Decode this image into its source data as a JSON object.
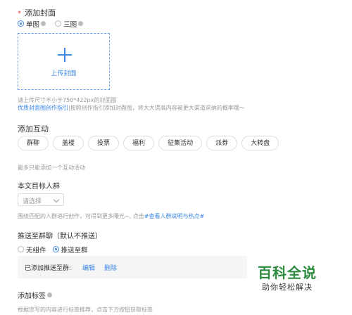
{
  "cover": {
    "required_mark": "*",
    "title": "添加封面",
    "options": [
      {
        "label": "单图",
        "selected": true
      },
      {
        "label": "三图",
        "selected": false
      }
    ],
    "upload_label": "上传封面",
    "hint_line1": "请上传尺寸不小于750*422px的封面图",
    "hint_link": "优质封面图创作指引",
    "hint_line2_rest": "|按照创作指引添加封面图，将大大提高内容被更大渠道采纳的概率哦～"
  },
  "interaction": {
    "title": "添加互动",
    "chips": [
      "群聊",
      "盖楼",
      "投票",
      "福利",
      "征集活动",
      "派券",
      "大转盘"
    ],
    "note": "最多只能添加一个互动活动"
  },
  "audience": {
    "title": "本文目标人群",
    "select_placeholder": "请选择",
    "hint_prefix": "围绕匹配的人群进行创作，可得到更多曝光~, 点击",
    "hint_link": "#查看人群说明与热点#"
  },
  "push": {
    "title": "推送至群聊（默认不推送）",
    "options": [
      {
        "label": "无组件",
        "selected": false
      },
      {
        "label": "推送至群",
        "selected": true
      }
    ],
    "added_label": "已添加推送至群:",
    "edit_label": "编辑",
    "delete_label": "删除"
  },
  "tags": {
    "title": "添加标签",
    "hint": "根据您写的内容进行标签推荐，点击下方按钮获取标签"
  },
  "watermark": {
    "main": "百科全说",
    "sub": "助你轻松解决"
  },
  "colors": {
    "accent": "#3a86e6",
    "required": "#e64340",
    "watermark": "#2e8b3e"
  }
}
